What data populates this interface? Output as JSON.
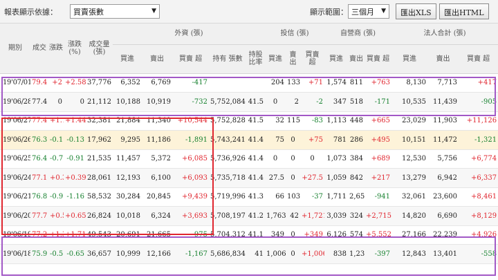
{
  "toolbar": {
    "display_by_label": "報表顯示依據：",
    "display_by_value": "買賣張數",
    "range_label": "顯示範圍：",
    "range_value": "三個月",
    "export_xls": "匯出XLS",
    "export_html": "匯出HTML"
  },
  "header": {
    "period": "期別",
    "close": "成交",
    "change": "漲跌",
    "change_pct": "漲跌 (%)",
    "volume": "成交量 (張)",
    "foreign": "外資 (張)",
    "trust": "投信 (張)",
    "dealer": "自營商 (張)",
    "total": "法人合計 (張)",
    "buy": "買進",
    "sell": "賣出",
    "net": "買賣 超",
    "holding": "持有 張數",
    "hold_ratio": "持股 比率"
  },
  "colors": {
    "up": "#e0262f",
    "down": "#17812f",
    "highlight_purple": "#a258c6",
    "highlight_red": "#e0262f",
    "highlight_row": "#fdf3d9"
  },
  "rows": [
    {
      "date": "19'07/01",
      "close": "79.4",
      "chg": "+2",
      "pct": "+2.58",
      "vol": "37,776",
      "f_buy": "6,352",
      "f_sell": "6,769",
      "f_net": "-417",
      "hold": "",
      "ratio": "",
      "t_buy": "204",
      "t_sell": "133",
      "t_net": "+71",
      "d_buy": "1,574",
      "d_sell": "811",
      "d_net": "+763",
      "a_buy": "8,130",
      "a_sell": "7,713",
      "a_net": "+417",
      "dir": "up"
    },
    {
      "date": "19'06/28",
      "close": "77.4",
      "chg": "0",
      "pct": "0",
      "vol": "21,112",
      "f_buy": "10,188",
      "f_sell": "10,919",
      "f_net": "-732",
      "hold": "5,752,084",
      "ratio": "41.5",
      "t_buy": "0",
      "t_sell": "2",
      "t_net": "-2",
      "d_buy": "347",
      "d_sell": "518",
      "d_net": "-171",
      "a_buy": "10,535",
      "a_sell": "11,439",
      "a_net": "-905",
      "dir": "flat"
    },
    {
      "date": "19'06/27",
      "close": "77.4",
      "chg": "+1.1",
      "pct": "+1.44",
      "vol": "32,381",
      "f_buy": "21,884",
      "f_sell": "11,340",
      "f_net": "+10,544",
      "hold": "5,752,828",
      "ratio": "41.5",
      "t_buy": "32",
      "t_sell": "115",
      "t_net": "-83",
      "d_buy": "1,113",
      "d_sell": "448",
      "d_net": "+665",
      "a_buy": "23,029",
      "a_sell": "11,903",
      "a_net": "+11,126",
      "dir": "up"
    },
    {
      "date": "19'06/26",
      "close": "76.3",
      "chg": "-0.1",
      "pct": "-0.13",
      "vol": "17,962",
      "f_buy": "9,295",
      "f_sell": "11,186",
      "f_net": "-1,891",
      "hold": "5,743,241",
      "ratio": "41.4",
      "t_buy": "75",
      "t_sell": "0",
      "t_net": "+75",
      "d_buy": "781",
      "d_sell": "286",
      "d_net": "+495",
      "a_buy": "10,151",
      "a_sell": "11,472",
      "a_net": "-1,321",
      "dir": "dn"
    },
    {
      "date": "19'06/25",
      "close": "76.4",
      "chg": "-0.7",
      "pct": "-0.91",
      "vol": "21,535",
      "f_buy": "11,457",
      "f_sell": "5,372",
      "f_net": "+6,085",
      "hold": "5,736,926",
      "ratio": "41.4",
      "t_buy": "0",
      "t_sell": "0",
      "t_net": "0",
      "d_buy": "1,073",
      "d_sell": "384",
      "d_net": "+689",
      "a_buy": "12,530",
      "a_sell": "5,756",
      "a_net": "+6,774",
      "dir": "dn"
    },
    {
      "date": "19'06/24",
      "close": "77.1",
      "chg": "+0.3",
      "pct": "+0.39",
      "vol": "28,061",
      "f_buy": "12,193",
      "f_sell": "6,100",
      "f_net": "+6,093",
      "hold": "5,735,718",
      "ratio": "41.4",
      "t_buy": "27.5",
      "t_sell": "0",
      "t_net": "+27.5",
      "d_buy": "1,059",
      "d_sell": "842",
      "d_net": "+217",
      "a_buy": "13,279",
      "a_sell": "6,942",
      "a_net": "+6,337",
      "dir": "up"
    },
    {
      "date": "19'06/21",
      "close": "76.8",
      "chg": "-0.9",
      "pct": "-1.16",
      "vol": "58,532",
      "f_buy": "30,284",
      "f_sell": "20,845",
      "f_net": "+9,439",
      "hold": "5,719,996",
      "ratio": "41.3",
      "t_buy": "66",
      "t_sell": "103",
      "t_net": "-37",
      "d_buy": "1,711",
      "d_sell": "2,652",
      "d_net": "-941",
      "a_buy": "32,061",
      "a_sell": "23,600",
      "a_net": "+8,461",
      "dir": "dn"
    },
    {
      "date": "19'06/20",
      "close": "77.7",
      "chg": "+0.5",
      "pct": "+0.65",
      "vol": "26,824",
      "f_buy": "10,018",
      "f_sell": "6,324",
      "f_net": "+3,693",
      "hold": "5,708,197",
      "ratio": "41.2",
      "t_buy": "1,763",
      "t_sell": "42",
      "t_net": "+1,721",
      "d_buy": "3,039",
      "d_sell": "324",
      "d_net": "+2,715",
      "a_buy": "14,820",
      "a_sell": "6,690",
      "a_net": "+8,129",
      "dir": "up"
    },
    {
      "date": "19'06/19",
      "close": "77.2",
      "chg": "+1.3",
      "pct": "+1.71",
      "vol": "49,543",
      "f_buy": "20,691",
      "f_sell": "21,665",
      "f_net": "-975",
      "hold": "5,704,312",
      "ratio": "41.1",
      "t_buy": "349",
      "t_sell": "0",
      "t_net": "+349",
      "d_buy": "6,126",
      "d_sell": "574",
      "d_net": "+5,552",
      "a_buy": "27,166",
      "a_sell": "22,239",
      "a_net": "+4,926",
      "dir": "up"
    },
    {
      "date": "19'06/18",
      "close": "75.9",
      "chg": "-0.5",
      "pct": "-0.65",
      "vol": "36,657",
      "f_buy": "10,999",
      "f_sell": "12,166",
      "f_net": "-1,167",
      "hold": "5,686,834",
      "ratio": "41",
      "t_buy": "1,006",
      "t_sell": "0",
      "t_net": "+1,006",
      "d_buy": "838",
      "d_sell": "1,235",
      "d_net": "-397",
      "a_buy": "12,843",
      "a_sell": "13,401",
      "a_net": "-558",
      "dir": "dn"
    }
  ]
}
